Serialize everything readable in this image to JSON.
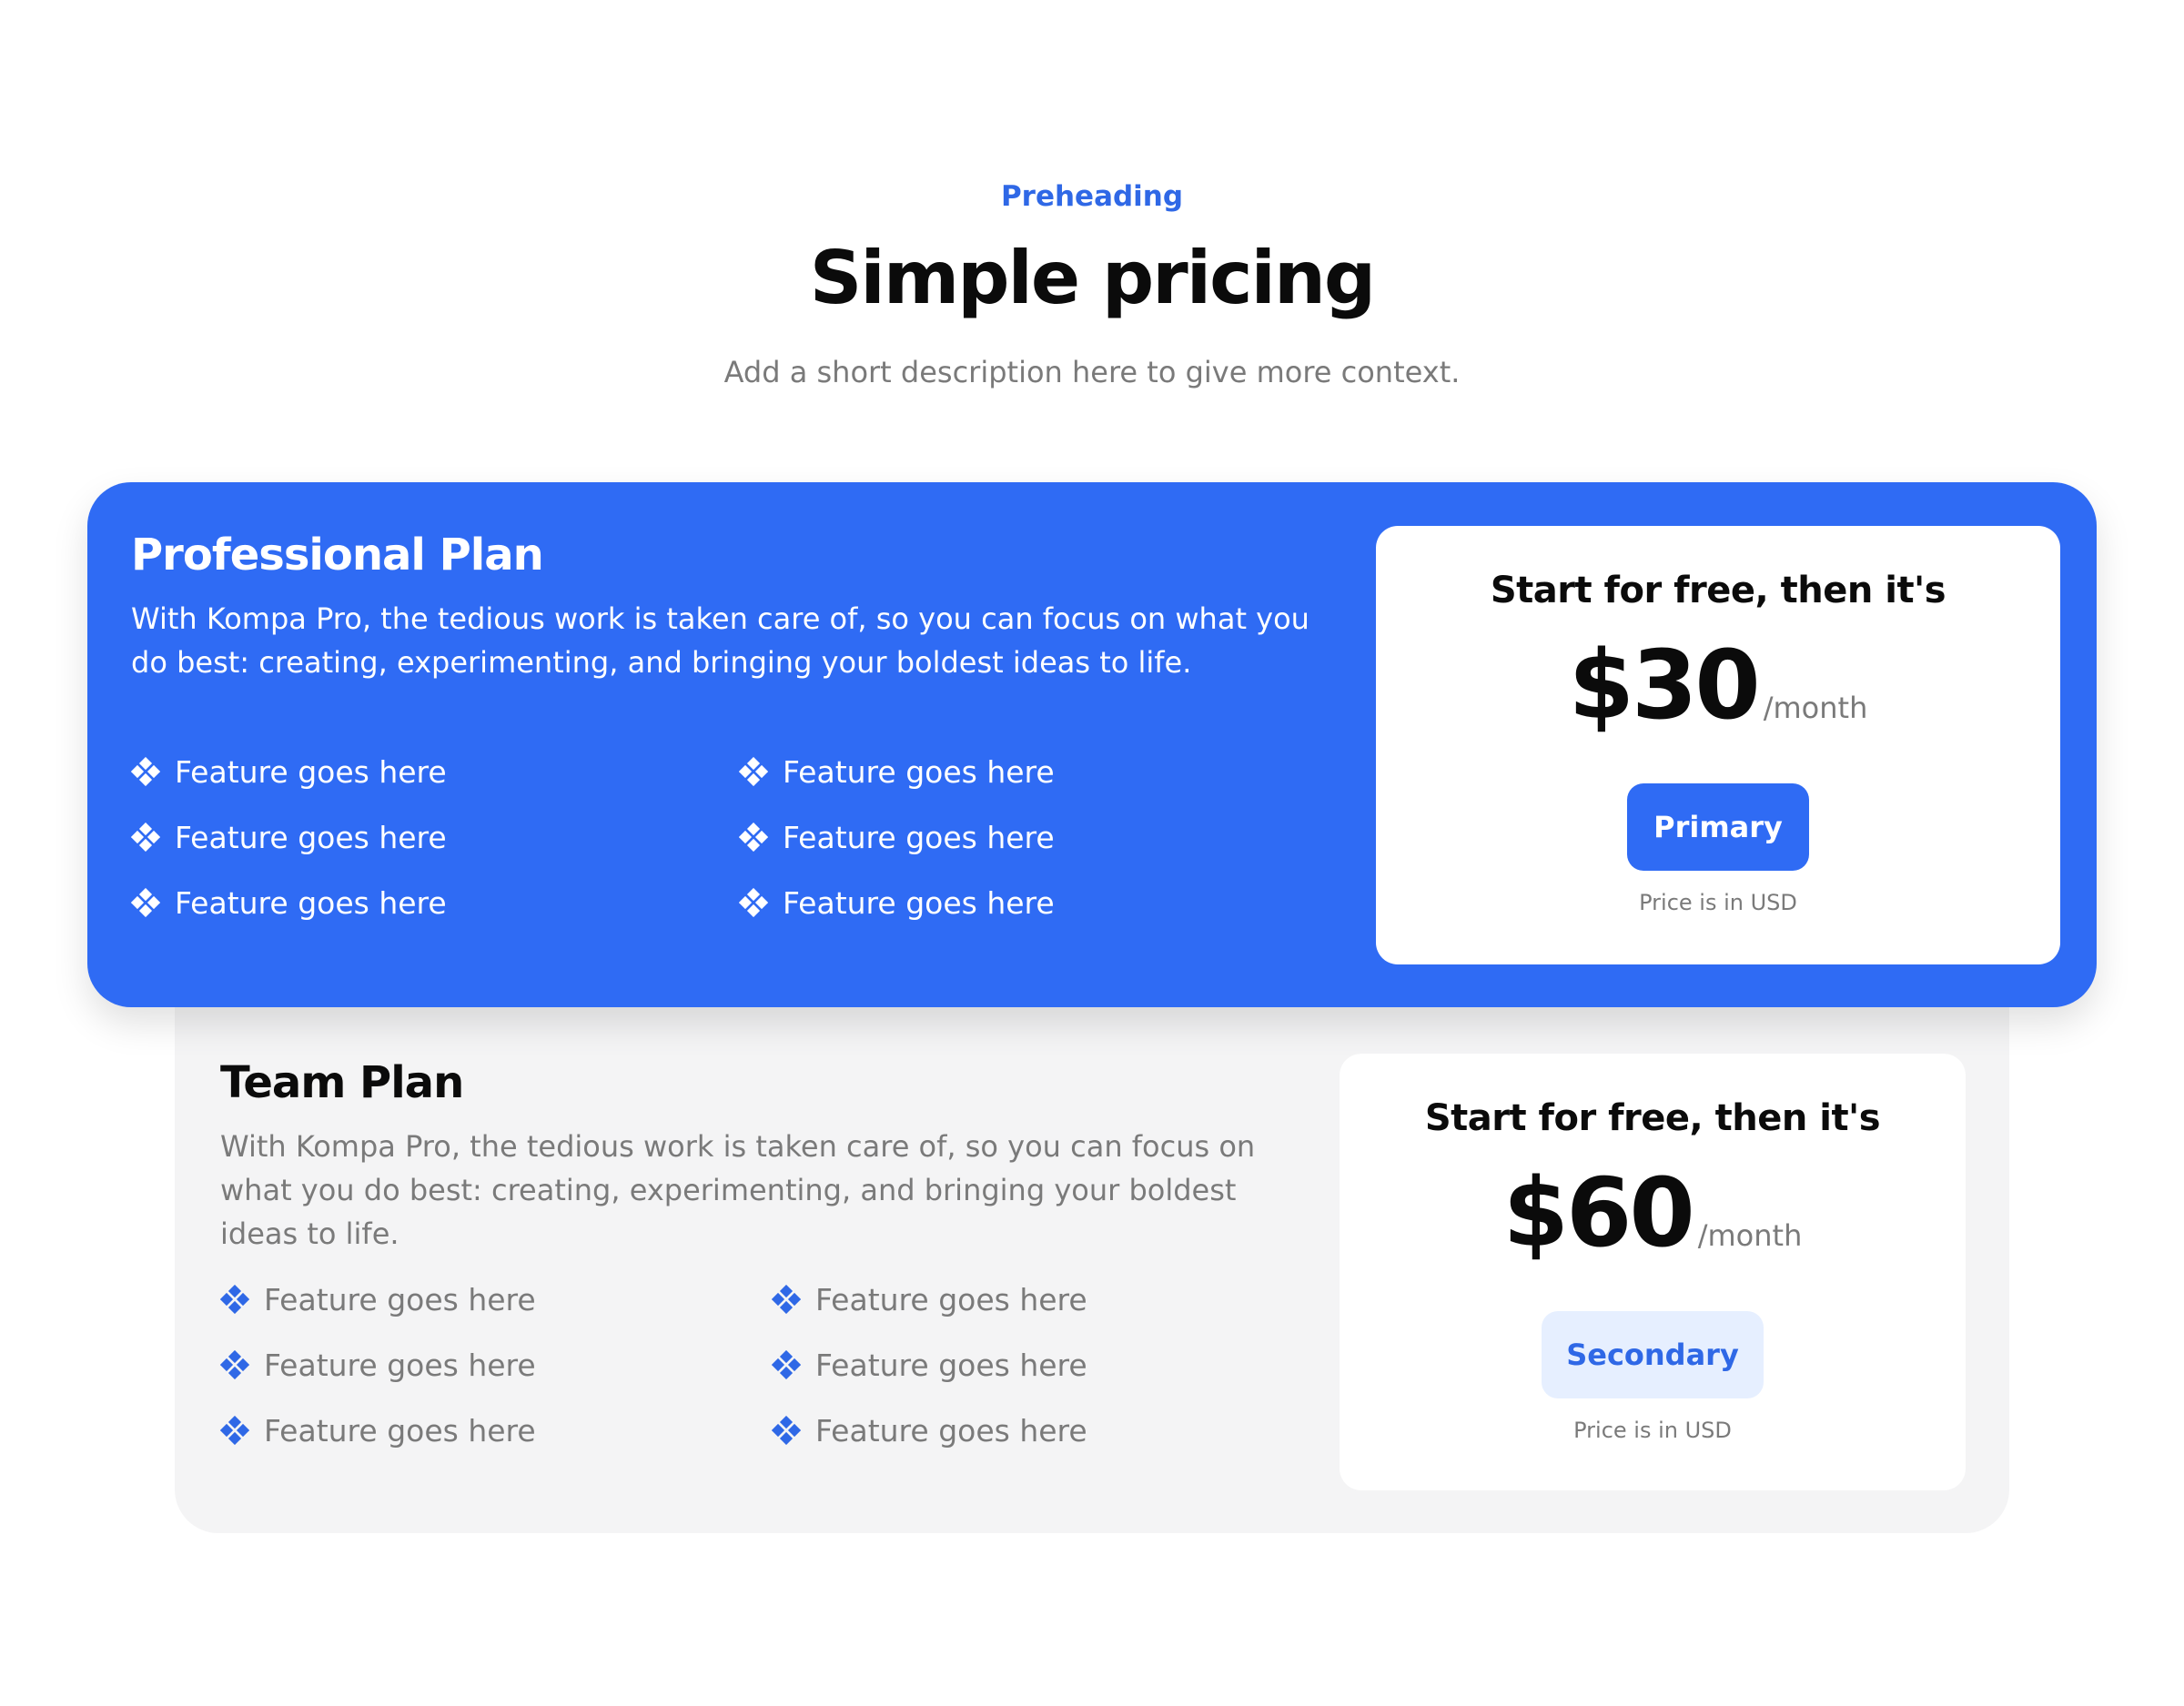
{
  "header": {
    "preheading": "Preheading",
    "title": "Simple pricing",
    "description": "Add a short description here to give more context."
  },
  "plans": [
    {
      "name": "Professional Plan",
      "description": "With Kompa Pro, the tedious work is taken care of, so you can focus on what you do best: creating, experimenting, and bringing your boldest ideas to life.",
      "features": [
        "Feature goes here",
        "Feature goes here",
        "Feature goes here",
        "Feature goes here",
        "Feature goes here",
        "Feature goes here"
      ],
      "tagline": "Start for free, then it's",
      "price": "$30",
      "price_unit": "/month",
      "button_label": "Primary",
      "note": "Price is in USD"
    },
    {
      "name": "Team Plan",
      "description": "With Kompa Pro, the tedious work is taken care of, so you can focus on what you do best: creating, experimenting, and bringing your boldest ideas to life.",
      "features": [
        "Feature goes here",
        "Feature goes here",
        "Feature goes here",
        "Feature goes here",
        "Feature goes here",
        "Feature goes here"
      ],
      "tagline": "Start for free, then it's",
      "price": "$60",
      "price_unit": "/month",
      "button_label": "Secondary",
      "note": "Price is in USD"
    }
  ],
  "icons": {
    "feature": "diamond-cluster-icon"
  },
  "colors": {
    "accent": "#2f6bf4",
    "accent_text": "#2f68e6",
    "secondary_bg": "#e6efff",
    "team_card_bg": "#f4f4f5"
  }
}
